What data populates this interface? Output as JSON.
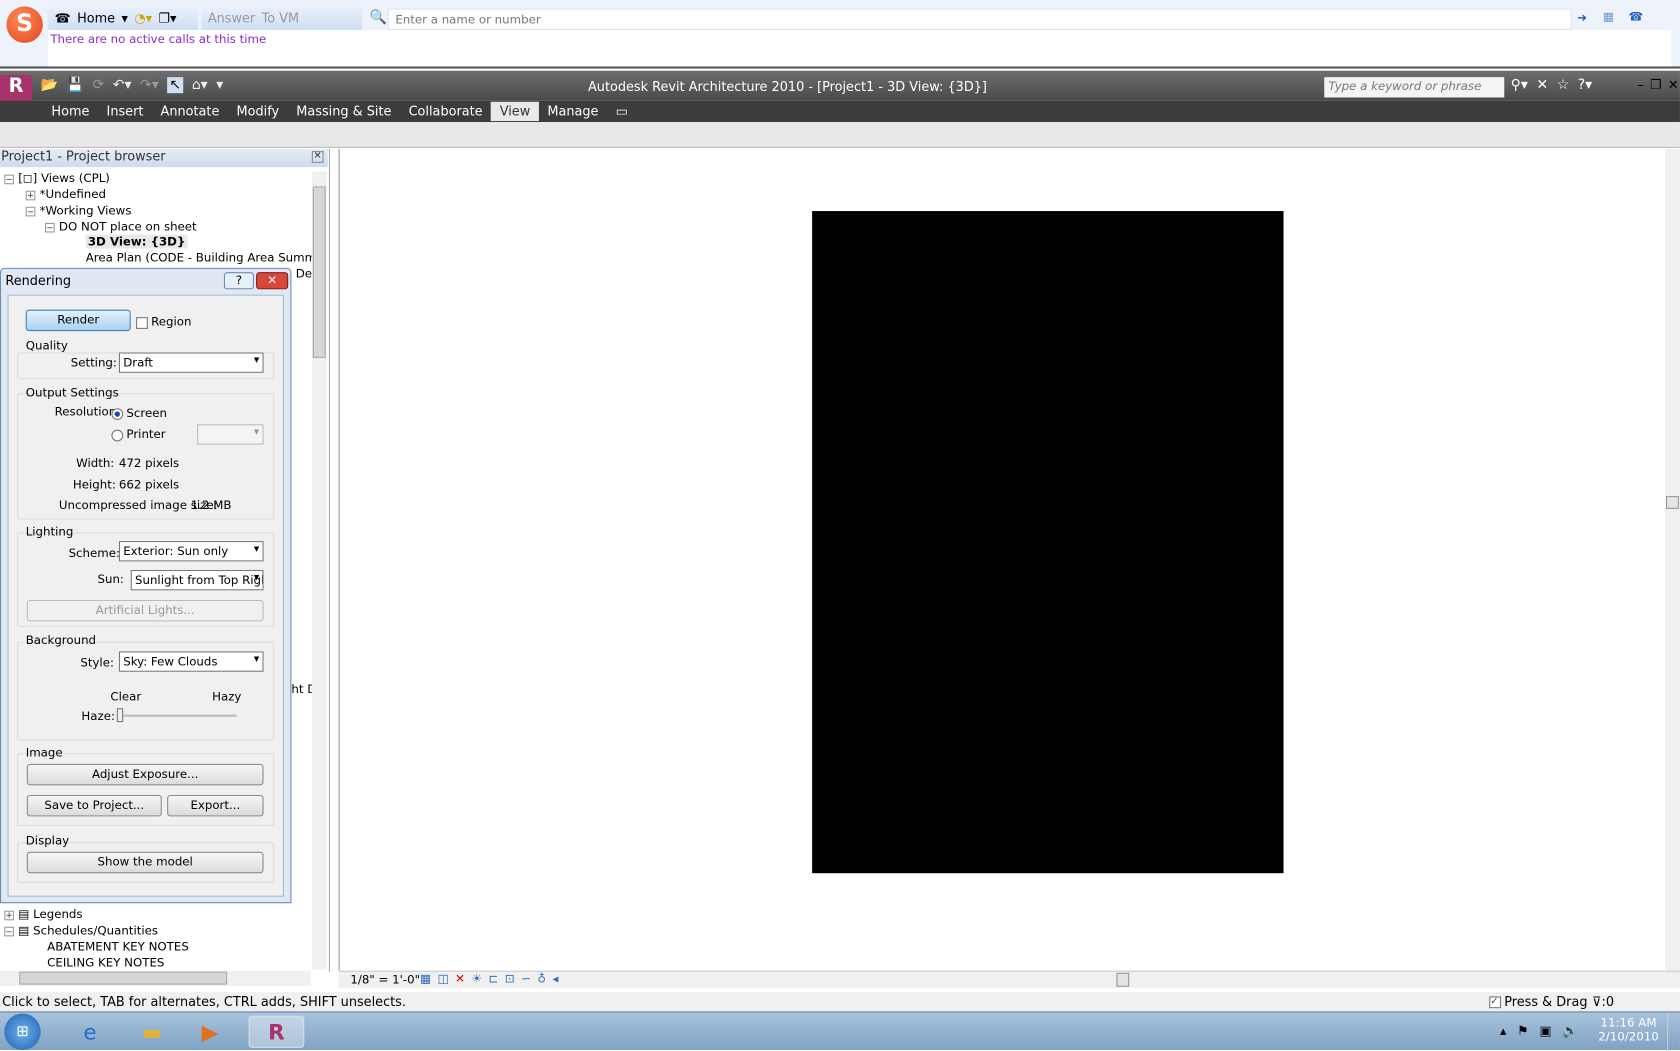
{
  "phone_bar": {
    "home_label": "Home",
    "answer_label": "Answer",
    "to_vm_label": "To VM",
    "search_placeholder": "Enter a name or number",
    "message": "There are no active calls at this time"
  },
  "app": {
    "title": "Autodesk Revit Architecture 2010 - [Project1 - 3D View: {3D}]",
    "keyword_placeholder": "Type a keyword or phrase"
  },
  "ribbon_tabs": [
    "Home",
    "Insert",
    "Annotate",
    "Modify",
    "Massing & Site",
    "Collaborate",
    "View",
    "Manage"
  ],
  "project_browser": {
    "title": "Project1 - Project browser",
    "items": [
      "Views (CPL)",
      "*Undefined",
      "*Working Views",
      "DO NOT place on sheet",
      "3D View: {3D}",
      "Area Plan (CODE - Building Area Summary): L",
      "De",
      "ht D",
      "Legends",
      "Schedules/Quantities",
      "ABATEMENT KEY NOTES",
      "CEILING KEY NOTES"
    ]
  },
  "rendering": {
    "title": "Rendering",
    "help": "?",
    "render_label": "Render",
    "region_label": "Region",
    "quality": {
      "heading": "Quality",
      "setting_label": "Setting:",
      "setting_value": "Draft"
    },
    "output": {
      "heading": "Output Settings",
      "resolution_label": "Resolution:",
      "screen_label": "Screen",
      "printer_label": "Printer",
      "width_label": "Width:",
      "width_value": "472 pixels",
      "height_label": "Height:",
      "height_value": "662 pixels",
      "size_label": "Uncompressed image size:",
      "size_value": "1.2 MB"
    },
    "lighting": {
      "heading": "Lighting",
      "scheme_label": "Scheme:",
      "scheme_value": "Exterior: Sun only",
      "sun_label": "Sun:",
      "sun_value": "Sunlight from Top Right",
      "artificial_label": "Artificial Lights..."
    },
    "background": {
      "heading": "Background",
      "style_label": "Style:",
      "style_value": "Sky: Few Clouds",
      "clear_label": "Clear",
      "hazy_label": "Hazy",
      "haze_label": "Haze:",
      "haze_value": 0
    },
    "image": {
      "heading": "Image",
      "adjust_label": "Adjust Exposure...",
      "save_label": "Save to Project...",
      "export_label": "Export..."
    },
    "display": {
      "heading": "Display",
      "show_label": "Show the model"
    }
  },
  "view_bar": {
    "scale": "1/8\" = 1'-0\""
  },
  "status": {
    "message": "Click to select, TAB for alternates, CTRL adds, SHIFT unselects.",
    "press_drag": "Press & Drag",
    "filter_count": ":0"
  },
  "taskbar": {
    "time": "11:16 AM",
    "date": "2/10/2010"
  }
}
